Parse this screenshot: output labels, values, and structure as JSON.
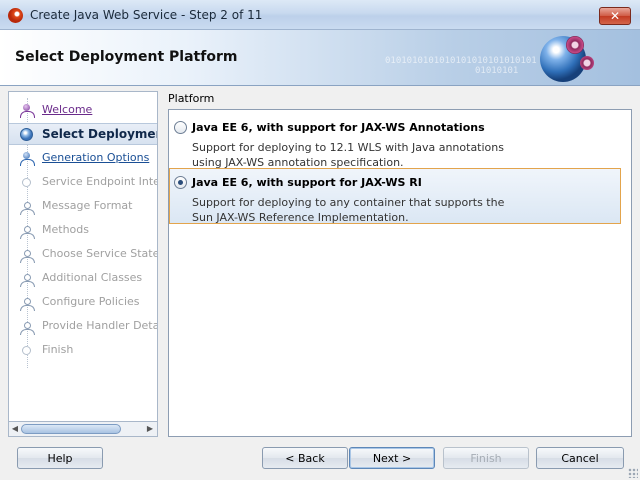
{
  "window": {
    "title": "Create Java Web Service - Step 2 of 11",
    "close_label": "✕"
  },
  "header": {
    "title": "Select Deployment Platform",
    "binary_text": "0101010101010101010101010101",
    "binary_text2": "01010101"
  },
  "nav": {
    "items": [
      {
        "label": "Welcome",
        "state": "visited"
      },
      {
        "label": "Select Deployment Platform",
        "state": "current"
      },
      {
        "label": "Generation Options",
        "state": "link"
      },
      {
        "label": "Service Endpoint Interface",
        "state": "disabled"
      },
      {
        "label": "Message Format",
        "state": "disabled"
      },
      {
        "label": "Methods",
        "state": "disabled"
      },
      {
        "label": "Choose Service State",
        "state": "disabled"
      },
      {
        "label": "Additional Classes",
        "state": "disabled"
      },
      {
        "label": "Configure Policies",
        "state": "disabled"
      },
      {
        "label": "Provide Handler Details",
        "state": "disabled"
      },
      {
        "label": "Finish",
        "state": "disabled"
      }
    ]
  },
  "platform": {
    "label": "Platform",
    "options": [
      {
        "title": "Java EE 6, with support for JAX-WS Annotations",
        "desc_line1": "Support for deploying to 12.1 WLS with Java annotations",
        "desc_line2": "using JAX-WS annotation specification.",
        "selected": false
      },
      {
        "title": "Java EE 6, with support for JAX-WS RI",
        "desc_line1": "Support for deploying to any container that supports the",
        "desc_line2": "Sun JAX-WS Reference Implementation.",
        "selected": true
      }
    ]
  },
  "buttons": {
    "help": "Help",
    "back": "< Back",
    "next": "Next >",
    "finish": "Finish",
    "cancel": "Cancel"
  },
  "colors": {
    "selection_border": "#e3a44c",
    "visited_link": "#6a2a8a",
    "link": "#1a4f95",
    "disabled_text": "#a0a0a0"
  }
}
